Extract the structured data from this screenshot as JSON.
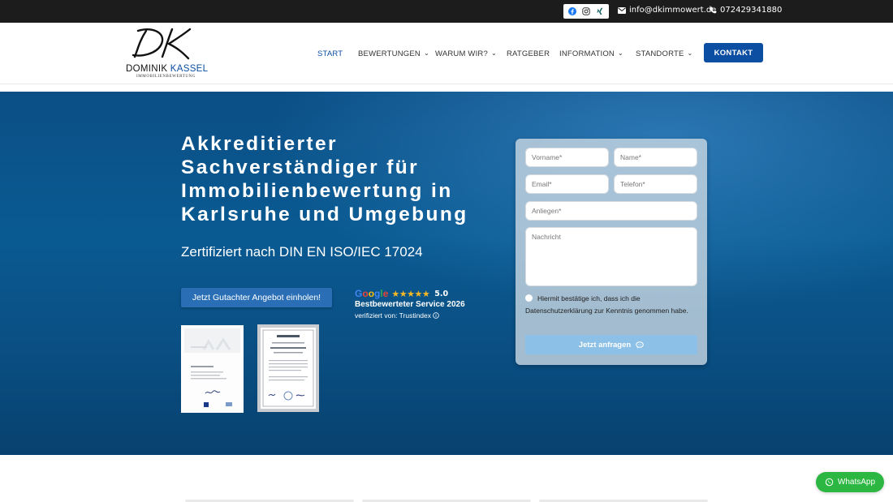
{
  "topbar": {
    "social_icons": [
      "facebook-icon",
      "instagram-icon",
      "xing-icon"
    ],
    "email": "info@dkimmowert.de",
    "phone": "072429341880"
  },
  "header": {
    "logo_monogram": "DK",
    "logo_name_first": "DOMINIK",
    "logo_name_last": "KASSEL",
    "logo_tagline": "IMMOBILIENBEWERTUNG",
    "nav": [
      {
        "label": "START",
        "active": true,
        "dropdown": false
      },
      {
        "label": "BEWERTUNGEN",
        "active": false,
        "dropdown": true
      },
      {
        "label": "WARUM WIR?",
        "active": false,
        "dropdown": true
      },
      {
        "label": "RATGEBER",
        "active": false,
        "dropdown": false
      },
      {
        "label": "INFORMATION",
        "active": false,
        "dropdown": true
      },
      {
        "label": "STANDORTE",
        "active": false,
        "dropdown": true
      }
    ],
    "cta_label": "KONTAKT"
  },
  "hero": {
    "title_lines": [
      "Akkreditierter",
      "Sachverständiger für",
      "Immobilienbewertung in",
      "Karlsruhe und Umgebung"
    ],
    "subtitle": "Zertifiziert nach DIN EN ISO/IEC 17024",
    "cta_label": "Jetzt Gutachter Angebot einholen!",
    "google_badge": {
      "brand": "Google",
      "stars": "★★★★★",
      "rating": "5.0",
      "headline": "Bestbewerteter Service 2026",
      "verified": "verifiziert von: Trustindex"
    }
  },
  "form": {
    "firstname_placeholder": "Vorname*",
    "lastname_placeholder": "Name*",
    "email_placeholder": "Email*",
    "phone_placeholder": "Telefon*",
    "concern_placeholder": "Anliegen*",
    "message_placeholder": "Nachricht",
    "consent_text": "Hiermit bestätige ich, dass ich die Datenschutzerklärung zur Kenntnis genommen habe.",
    "submit_label": "Jetzt anfragen"
  },
  "whatsapp": {
    "label": "WhatsApp"
  },
  "colors": {
    "brand_blue": "#0b4ea2",
    "hero_blue": "#0a5a92",
    "whatsapp_green": "#2bb741",
    "star_yellow": "#f6b923"
  }
}
